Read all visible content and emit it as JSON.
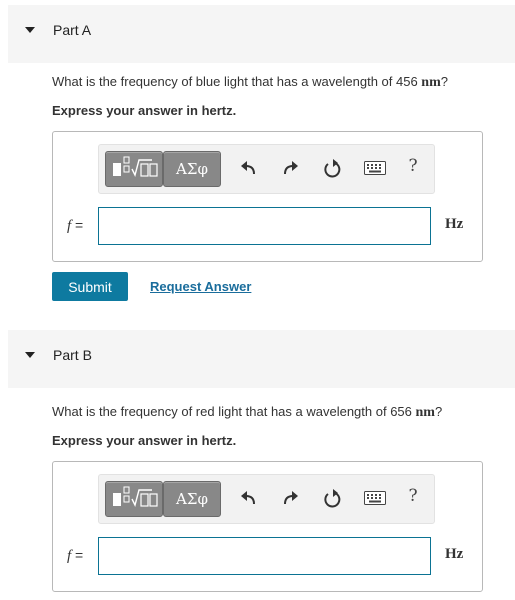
{
  "parts": [
    {
      "title": "Part A",
      "question_prefix": "What is the frequency of blue light that has a wavelength of 456 ",
      "question_unit": "nm",
      "question_suffix": "?",
      "instruction": "Express your answer in hertz.",
      "variable": "f",
      "equals": " =",
      "answer_value": "",
      "answer_unit": "Hz",
      "submit_label": "Submit",
      "request_label": "Request Answer"
    },
    {
      "title": "Part B",
      "question_prefix": "What is the frequency of red light that has a wavelength of 656 ",
      "question_unit": "nm",
      "question_suffix": "?",
      "instruction": "Express your answer in hertz.",
      "variable": "f",
      "equals": " =",
      "answer_value": "",
      "answer_unit": "Hz"
    }
  ],
  "toolbar": {
    "greek_label": "ΑΣφ",
    "help_label": "?",
    "icons": [
      "templates-icon",
      "greek-symbols-icon",
      "undo-icon",
      "redo-icon",
      "reset-icon",
      "keyboard-icon",
      "help-icon"
    ]
  },
  "colors": {
    "accent": "#0e7aa0",
    "link": "#1a6d9c",
    "header_bg": "#f5f5f5",
    "toolbar_button": "#888888"
  }
}
